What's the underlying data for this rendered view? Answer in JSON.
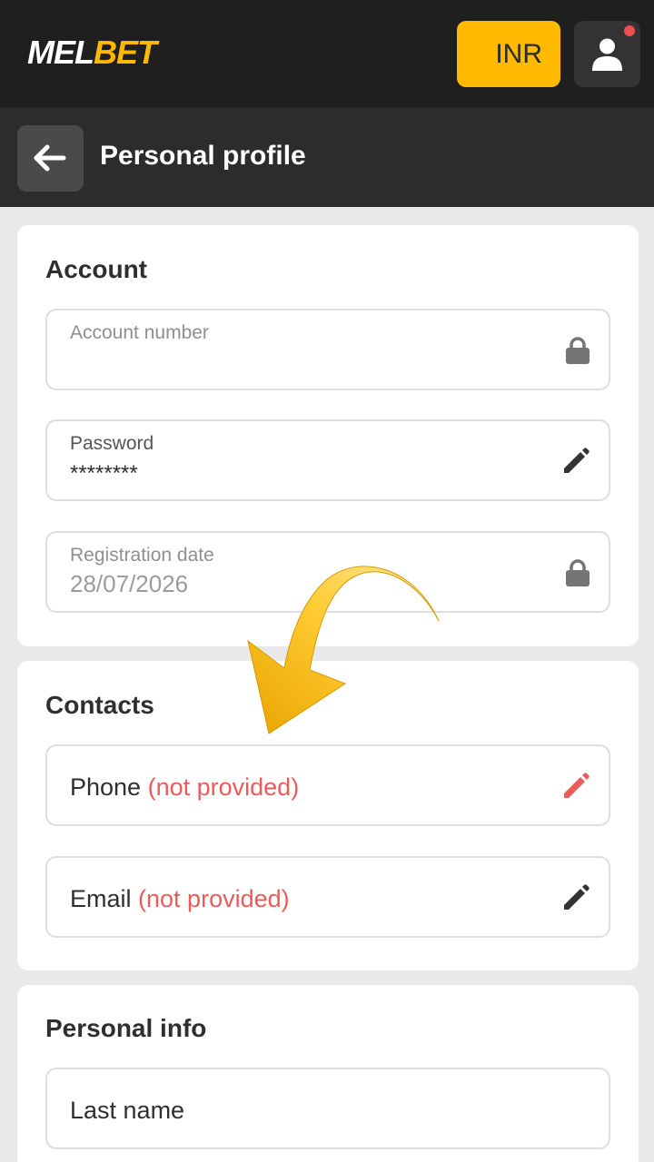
{
  "header": {
    "logo_part1": "MEL",
    "logo_part2": "BET",
    "currency": "INR",
    "profile_icon": "user-icon"
  },
  "subheader": {
    "back_icon": "arrow-left-icon",
    "title": "Personal profile"
  },
  "account": {
    "title": "Account",
    "account_number": {
      "label": "Account number",
      "value": "",
      "icon": "lock-icon"
    },
    "password": {
      "label": "Password",
      "value": "********",
      "icon": "pencil-icon"
    },
    "registration": {
      "label": "Registration date",
      "value": "28/07/2026",
      "icon": "lock-icon"
    }
  },
  "contacts": {
    "title": "Contacts",
    "phone": {
      "label": "Phone",
      "status": "(not provided)",
      "icon": "pencil-icon"
    },
    "email": {
      "label": "Email",
      "status": "(not provided)",
      "icon": "pencil-icon"
    }
  },
  "personal_info": {
    "title": "Personal info",
    "last_name": {
      "label": "Last name"
    }
  },
  "colors": {
    "accent": "#ffba00",
    "header_bg": "#1f1f1f",
    "subheader_bg": "#2c2c2c",
    "page_bg": "#e9e9e9",
    "warning_text": "#ec5a5a",
    "annotation_arrow": "#f5b400"
  }
}
